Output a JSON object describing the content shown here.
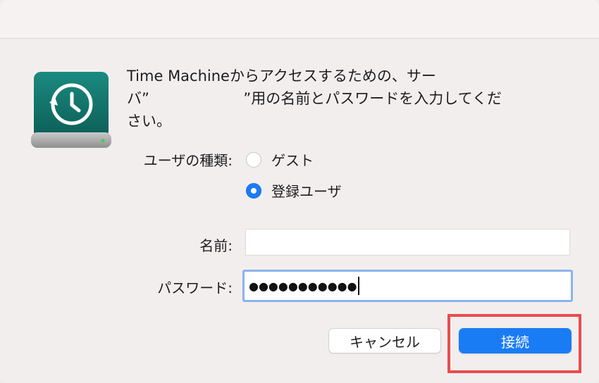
{
  "dialog": {
    "message_lines": [
      "Time Machineからアクセスするための、サー",
      "バ”                    ”用の名前とパスワードを入力してくだ",
      "さい。"
    ],
    "user_type_label": "ユーザの種類:",
    "radio_guest_label": "ゲスト",
    "radio_registered_label": "登録ユーザ",
    "selected_user_type": "登録ユーザ",
    "name_label": "名前:",
    "name_value": "",
    "password_label": "パスワード:",
    "password_value": "●●●●●●●●●●●",
    "cancel_label": "キャンセル",
    "connect_label": "接続"
  },
  "icon": {
    "name": "time-machine-disk-icon",
    "body_color": "#0f6e66",
    "highlight_box_color": "#e84d4d"
  },
  "colors": {
    "accent": "#1a7cf5",
    "background": "#f3eeee"
  }
}
